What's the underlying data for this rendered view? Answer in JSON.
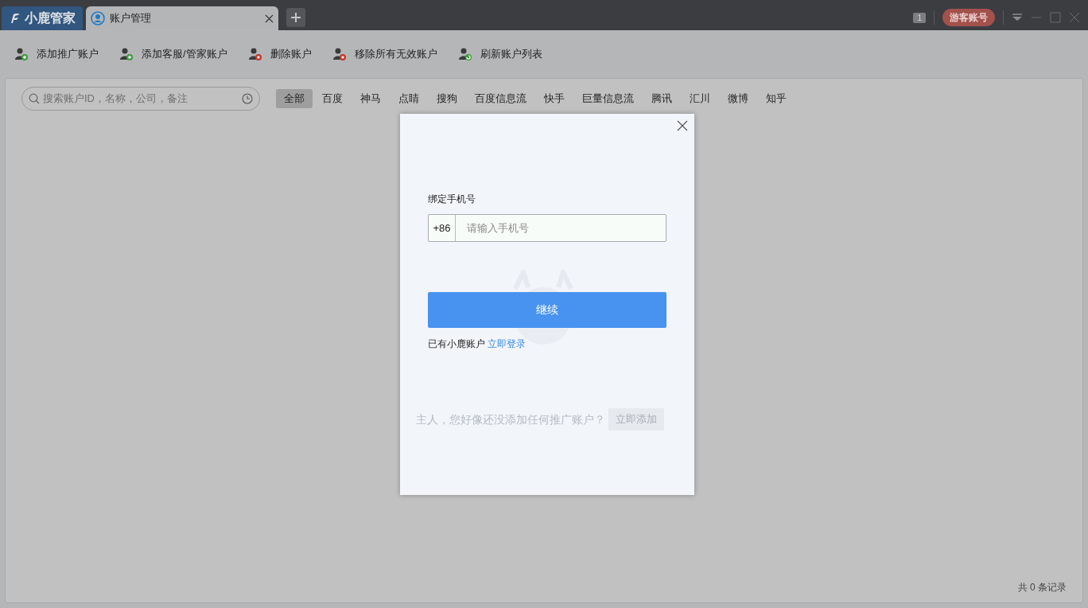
{
  "app": {
    "logo": "小鹿管家"
  },
  "tabs": [
    {
      "label": "账户管理",
      "selected": true
    }
  ],
  "title_bar": {
    "badge_count": "1",
    "guest_label": "游客账号"
  },
  "toolbar": [
    {
      "label": "添加推广账户",
      "kind": "add"
    },
    {
      "label": "添加客服/管家账户",
      "kind": "add"
    },
    {
      "label": "删除账户",
      "kind": "remove"
    },
    {
      "label": "移除所有无效账户",
      "kind": "remove"
    },
    {
      "label": "刷新账户列表",
      "kind": "refresh"
    }
  ],
  "search": {
    "placeholder": "搜索账户ID，名称，公司，备注"
  },
  "filters": [
    {
      "label": "全部",
      "selected": true
    },
    {
      "label": "百度",
      "selected": false
    },
    {
      "label": "神马",
      "selected": false
    },
    {
      "label": "点睛",
      "selected": false
    },
    {
      "label": "搜狗",
      "selected": false
    },
    {
      "label": "百度信息流",
      "selected": false
    },
    {
      "label": "快手",
      "selected": false
    },
    {
      "label": "巨量信息流",
      "selected": false
    },
    {
      "label": "腾讯",
      "selected": false
    },
    {
      "label": "汇川",
      "selected": false
    },
    {
      "label": "微博",
      "selected": false
    },
    {
      "label": "知乎",
      "selected": false
    }
  ],
  "empty_state": {
    "message": "主人，您好像还没添加任何推广账户？",
    "button": "立即添加"
  },
  "dialog": {
    "field_label": "绑定手机号",
    "country_code": "+86",
    "placeholder": "请输入手机号",
    "submit": "继续",
    "login_prompt": "已有小鹿账户",
    "login_link": "立即登录"
  },
  "status": {
    "records": "共 0 条记录"
  }
}
